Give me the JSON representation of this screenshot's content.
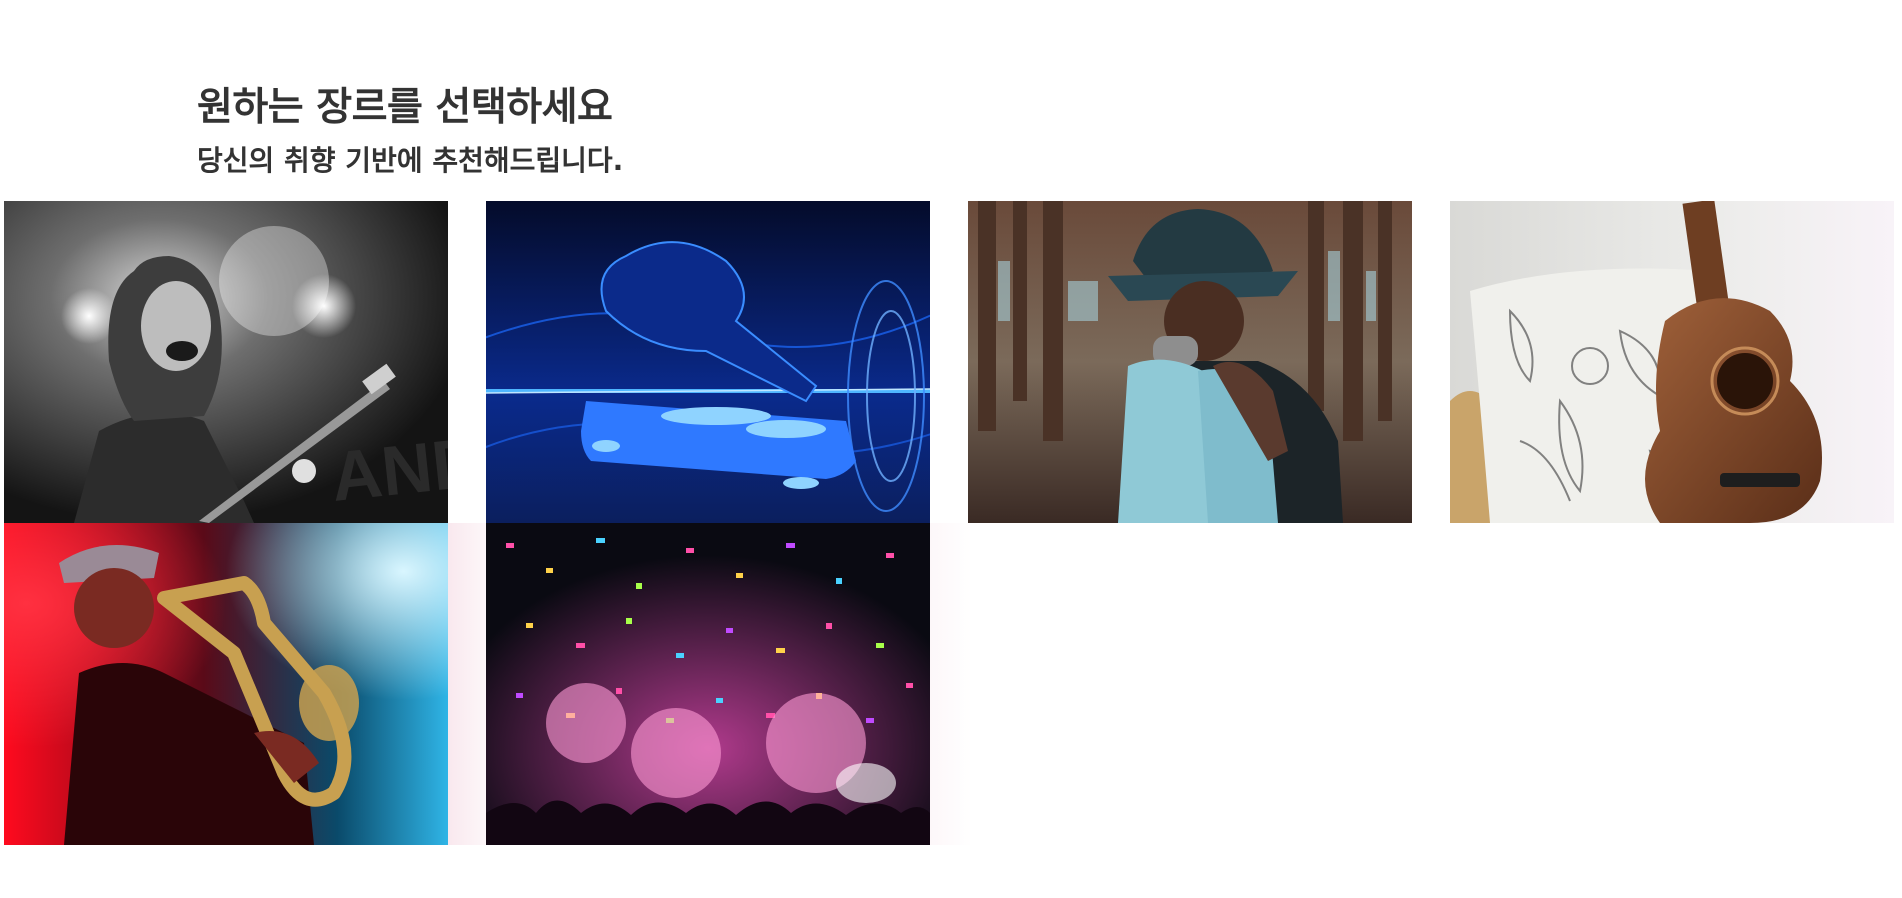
{
  "header": {
    "title": "원하는 장르를 선택하세요",
    "subtitle": "당신의 취향 기반에 추천해드립니다."
  },
  "genres": [
    {
      "id": "rock",
      "image": "rock-guitarist-photo"
    },
    {
      "id": "edm",
      "image": "dj-turntable-photo"
    },
    {
      "id": "hiphop",
      "image": "rapper-microphone-photo"
    },
    {
      "id": "acoustic",
      "image": "acoustic-guitar-photo"
    },
    {
      "id": "jazz",
      "image": "saxophone-player-photo"
    },
    {
      "id": "party",
      "image": "confetti-crowd-photo"
    }
  ]
}
